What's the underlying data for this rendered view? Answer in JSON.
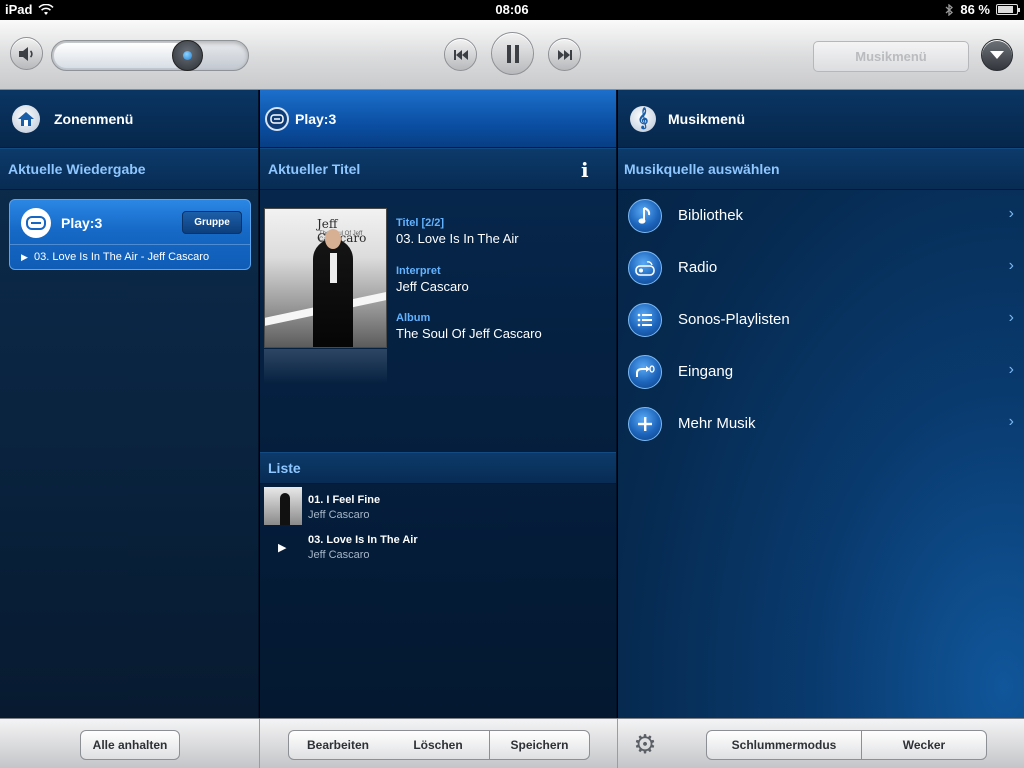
{
  "status": {
    "device": "iPad",
    "time": "08:06",
    "battery": "86 %",
    "battery_level": 0.86
  },
  "transport": {
    "volume_level": 0.69,
    "music_menu_label": "Musikmenü"
  },
  "zones": {
    "header": "Zonenmenü",
    "section": "Aktuelle Wiedergabe",
    "zone_name": "Play:3",
    "group_button": "Gruppe",
    "now_playing": "03. Love Is In The Air - Jeff Cascaro"
  },
  "now_playing": {
    "header": "Play:3",
    "section": "Aktueller Titel",
    "info_icon": "i",
    "album_art": {
      "name": "Jeff Cascaro",
      "sub": "The Soul Of Jeff Cascaro"
    },
    "title_label": "Titel [2/2]",
    "title_value": "03. Love Is In The Air",
    "artist_label": "Interpret",
    "artist_value": "Jeff Cascaro",
    "album_label": "Album",
    "album_value": "The Soul Of Jeff Cascaro",
    "queue_section": "Liste",
    "queue": [
      {
        "title": "01. I Feel Fine",
        "artist": "Jeff Cascaro"
      },
      {
        "title": "03. Love Is In The Air",
        "artist": "Jeff Cascaro"
      }
    ]
  },
  "music_menu": {
    "header": "Musikmenü",
    "section": "Musikquelle auswählen",
    "items": [
      {
        "label": "Bibliothek",
        "icon": "music-note-icon"
      },
      {
        "label": "Radio",
        "icon": "radio-icon"
      },
      {
        "label": "Sonos-Playlisten",
        "icon": "playlist-icon"
      },
      {
        "label": "Eingang",
        "icon": "line-in-icon"
      },
      {
        "label": "Mehr Musik",
        "icon": "plus-icon"
      }
    ]
  },
  "bottom": {
    "pause_all": "Alle anhalten",
    "edit": "Bearbeiten",
    "delete": "Löschen",
    "save": "Speichern",
    "sleep": "Schlummermodus",
    "alarm": "Wecker"
  }
}
